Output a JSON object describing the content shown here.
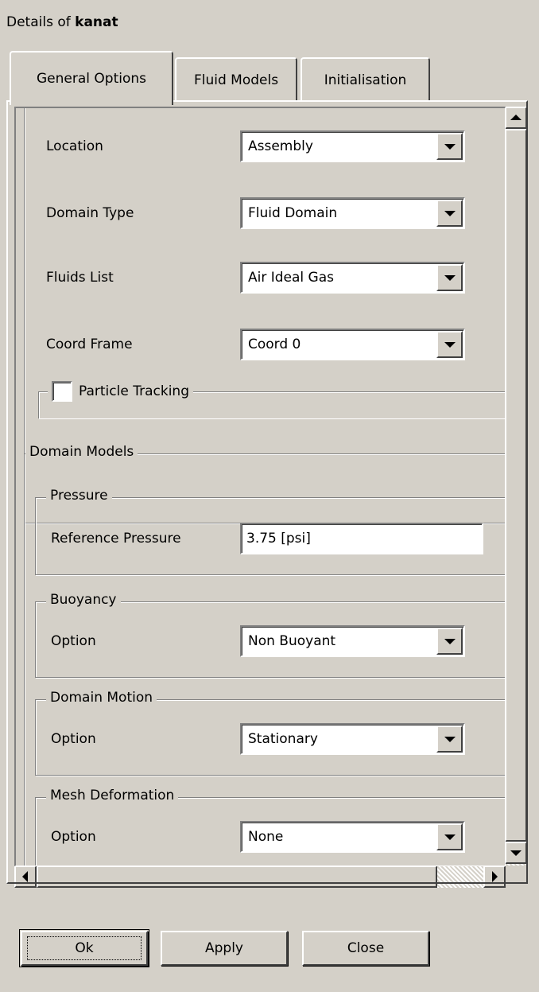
{
  "header": {
    "prefix": "Details of ",
    "object_name": "kanat"
  },
  "tabs": [
    {
      "label": "General Options",
      "active": true
    },
    {
      "label": "Fluid Models",
      "active": false
    },
    {
      "label": "Initialisation",
      "active": false
    }
  ],
  "basic_settings": {
    "location": {
      "label": "Location",
      "value": "Assembly"
    },
    "domain_type": {
      "label": "Domain Type",
      "value": "Fluid Domain"
    },
    "fluids_list": {
      "label": "Fluids List",
      "value": "Air Ideal Gas"
    },
    "coord_frame": {
      "label": "Coord Frame",
      "value": "Coord 0"
    },
    "particle_tracking": {
      "label": "Particle Tracking",
      "checked": false
    }
  },
  "domain_models": {
    "title": "Domain Models",
    "pressure": {
      "title": "Pressure",
      "reference_pressure": {
        "label": "Reference Pressure",
        "value": "3.75 [psi]"
      }
    },
    "buoyancy": {
      "title": "Buoyancy",
      "option_label": "Option",
      "value": "Non Buoyant"
    },
    "domain_motion": {
      "title": "Domain Motion",
      "option_label": "Option",
      "value": "Stationary"
    },
    "mesh_deformation": {
      "title": "Mesh Deformation",
      "option_label": "Option",
      "value": "None"
    }
  },
  "buttons": {
    "ok": "Ok",
    "apply": "Apply",
    "close": "Close"
  },
  "colors": {
    "face": "#d4d0c8",
    "shadow": "#808080",
    "dark": "#404040",
    "highlight": "#ffffff"
  }
}
